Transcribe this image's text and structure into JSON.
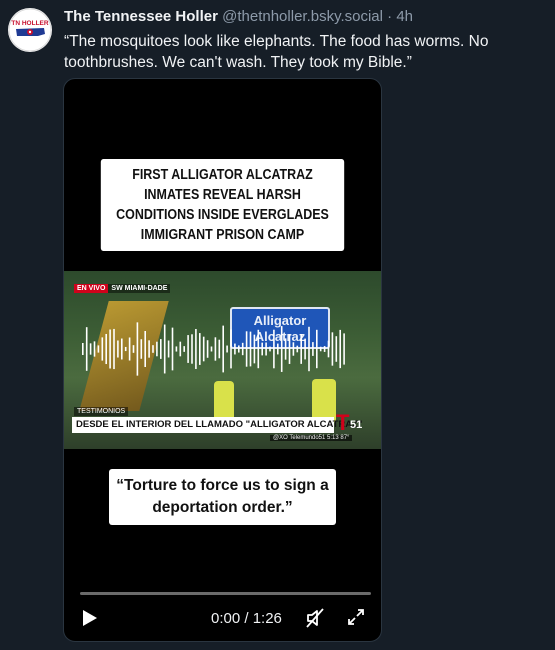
{
  "post": {
    "author": {
      "avatar_logo_text": "TN HOLLER",
      "display_name": "The Tennessee Holler",
      "handle": "@thetnholler.bsky.social",
      "separator": "·",
      "timestamp": "4h"
    },
    "text": "“The mosquitoes look like elephants. The food has worms. No toothbrushes. We can't wash. They took my Bible.”"
  },
  "video": {
    "headline": "FIRST ALLIGATOR ALCATRAZ INMATES REVEAL HARSH CONDITIONS INSIDE EVERGLADES IMMIGRANT PRISON CAMP",
    "news_frame": {
      "live_label": "EN VIVO",
      "location_label": "SW MIAMI-DADE",
      "sign_text": "Alligator Alcatraz",
      "section_label": "TESTIMONIOS",
      "lower_third": "DESDE EL INTERIOR DEL LLAMADO \"ALLIGATOR ALCATRAZ\"",
      "lower_sub": "@XO Telemundo51   5:13   87°",
      "channel_logo_t": "T",
      "channel_logo_number": "51"
    },
    "quote": "“Torture to force us to sign a deportation order.”",
    "controls": {
      "time": "0:00 / 1:26",
      "progress_fraction": 0,
      "play_icon": "play-icon",
      "mute_icon": "volume-muted-icon",
      "fullscreen_icon": "fullscreen-icon"
    }
  },
  "colors": {
    "background": "#161e27",
    "secondary_text": "#8d9aa9",
    "accent_red": "#d0021b"
  }
}
